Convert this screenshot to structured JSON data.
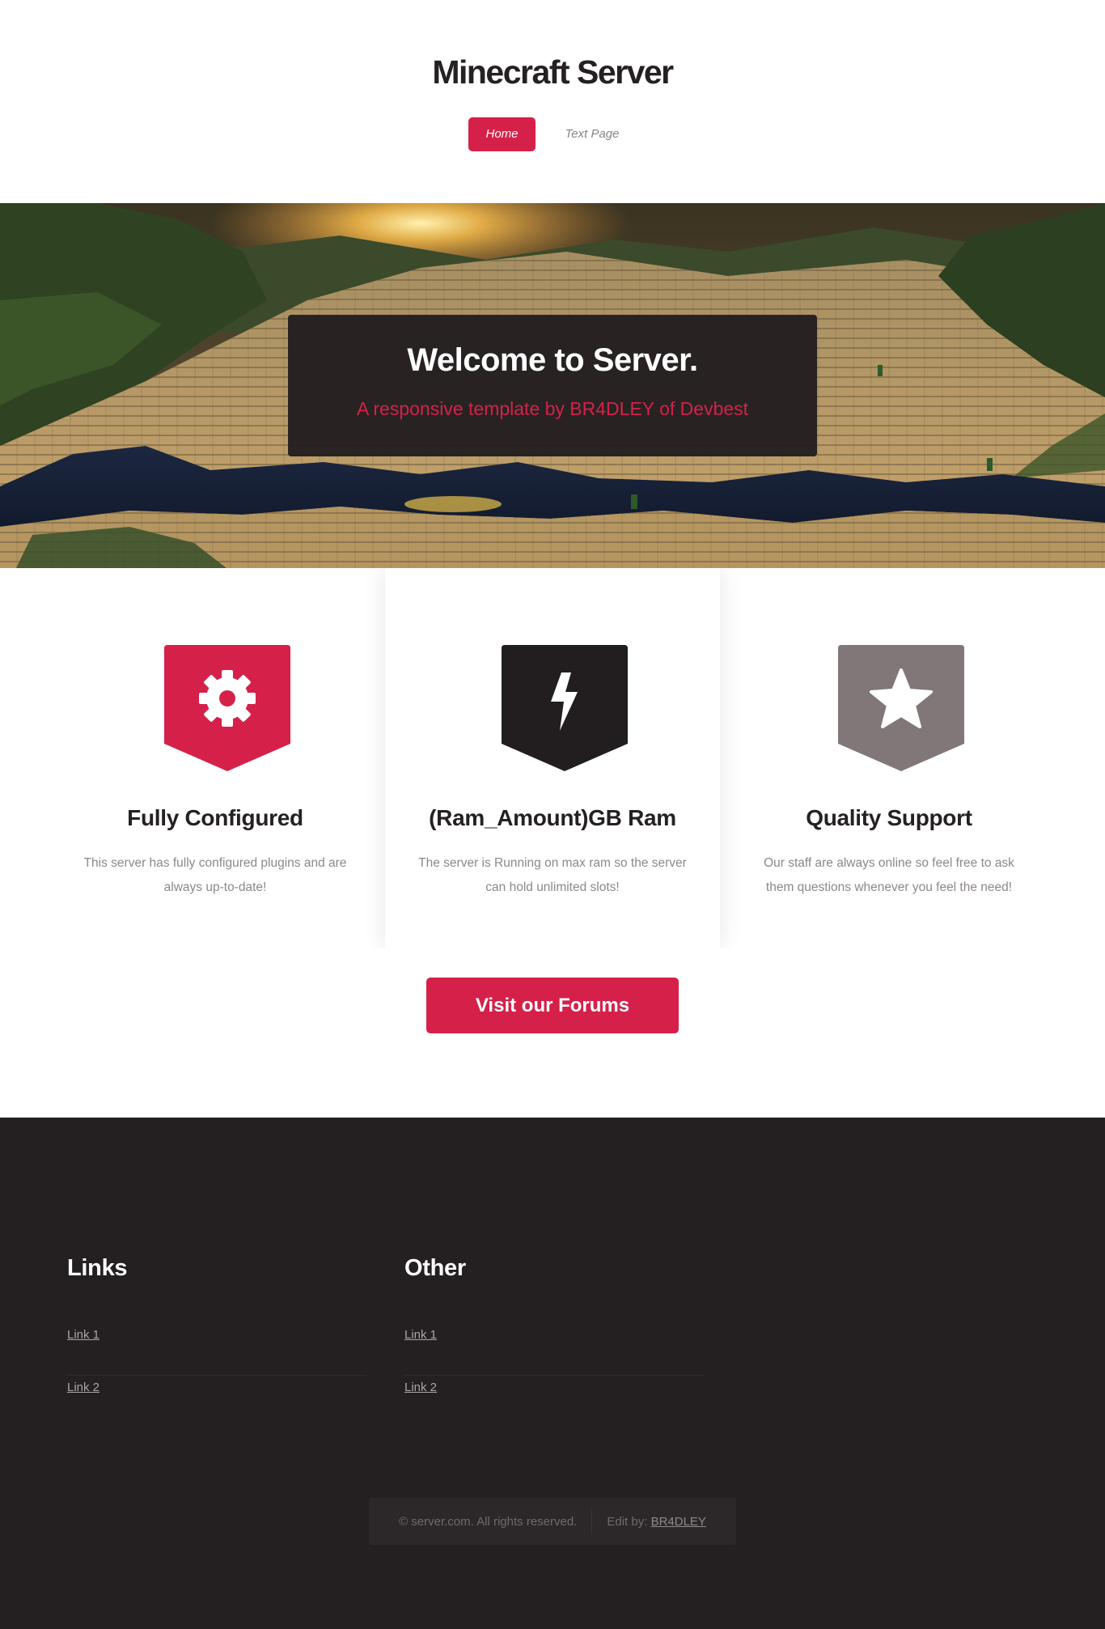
{
  "header": {
    "title": "Minecraft Server",
    "nav": [
      {
        "label": "Home",
        "active": true
      },
      {
        "label": "Text Page",
        "active": false
      }
    ]
  },
  "hero": {
    "title": "Welcome to Server.",
    "subtitle": "A responsive template by BR4DLEY of Devbest"
  },
  "features": [
    {
      "icon": "gear-icon",
      "color": "#d52149",
      "title": "Fully Configured",
      "text": "This server has fully configured plugins and are always up-to-date!"
    },
    {
      "icon": "lightning-bolt-icon",
      "color": "#221e1f",
      "title": "(Ram_Amount)GB Ram",
      "text": "The server is Running on max ram so the server can hold unlimited slots!"
    },
    {
      "icon": "star-icon",
      "color": "#817778",
      "title": "Quality Support",
      "text": "Our staff are always online so feel free to ask them questions whenever you feel the need!"
    }
  ],
  "cta": {
    "label": "Visit our Forums"
  },
  "footer": {
    "columns": [
      {
        "title": "Links",
        "links": [
          "Link 1",
          "Link 2"
        ]
      },
      {
        "title": "Other",
        "links": [
          "Link 1",
          "Link 2"
        ]
      }
    ],
    "copyright": "© server.com. All rights reserved.",
    "credit_prefix": "Edit by:",
    "credit_name": "BR4DLEY"
  },
  "colors": {
    "accent": "#d52149",
    "dark": "#242021",
    "grey_badge": "#817778"
  }
}
